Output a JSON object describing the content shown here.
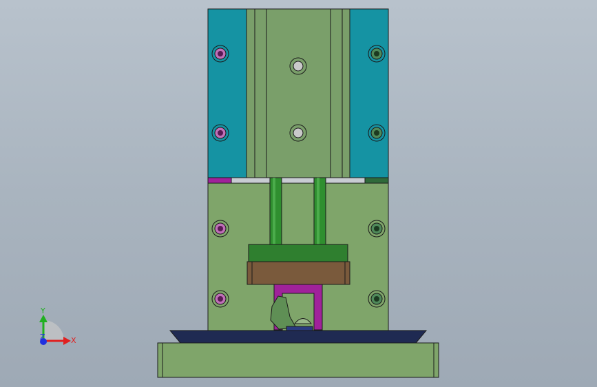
{
  "viewport": {
    "background_top": "#b8c2cc",
    "background_bottom": "#9ea9b5"
  },
  "model": {
    "colors": {
      "upper_block": "#7a9f6a",
      "side_plate": "#1593a3",
      "lower_block": "#7fa56a",
      "guide_rod": "#2f8f2f",
      "green_plate": "#2f7f2f",
      "brown_plate": "#7a5a3c",
      "magenta_frame": "#a0229a",
      "base_tray": "#1f2a52",
      "base_block": "#7fa56a",
      "outline": "#1a1a1a",
      "bolt_magenta": "#b04aa8",
      "bolt_green": "#3a6a3a"
    }
  },
  "triad": {
    "x_label": "X",
    "y_label": "Y",
    "z_label": "Z",
    "x_color": "#e02020",
    "y_color": "#20b020",
    "z_color": "#2030e0"
  }
}
